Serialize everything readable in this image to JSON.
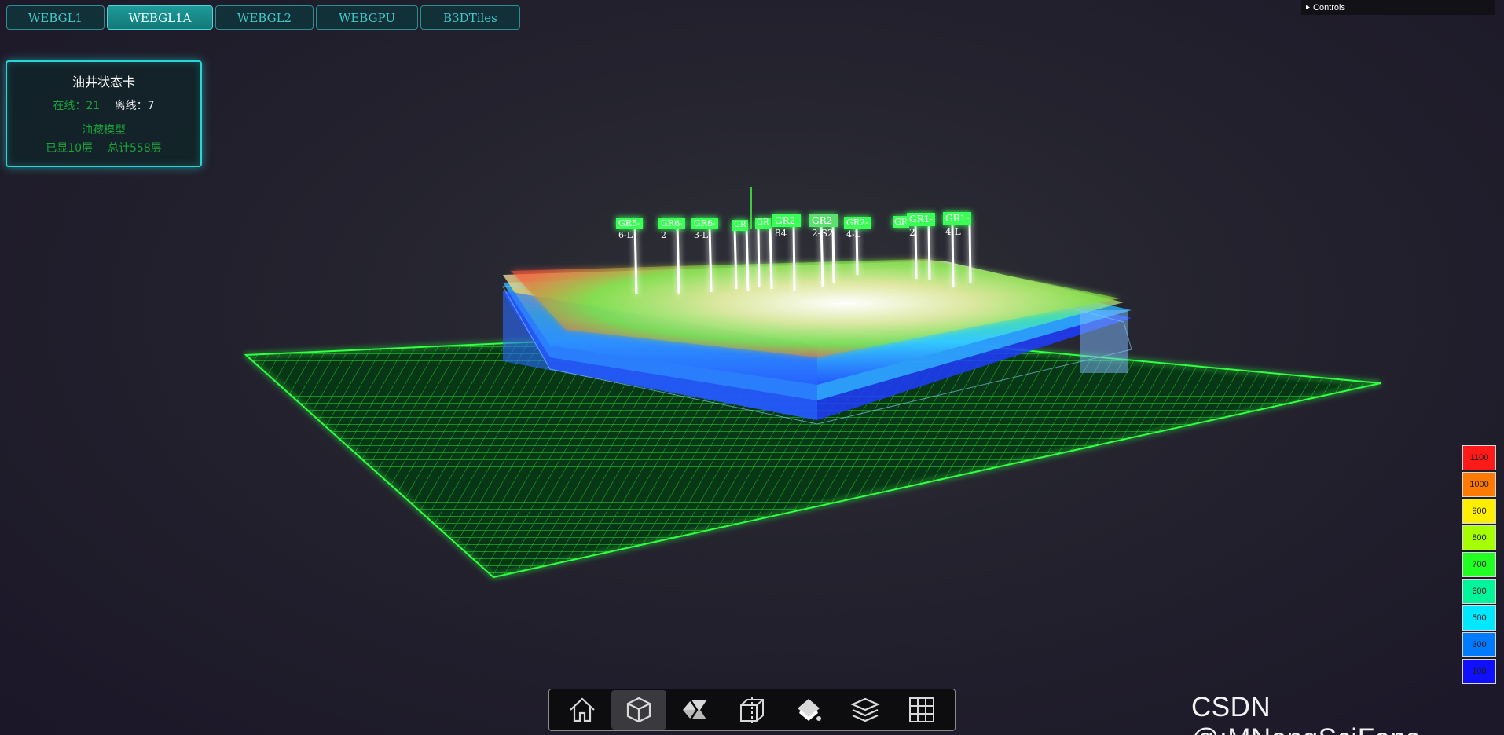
{
  "tabs": [
    {
      "label": "WEBGL1",
      "active": false
    },
    {
      "label": "WEBGL1A",
      "active": true
    },
    {
      "label": "WEBGL2",
      "active": false
    },
    {
      "label": "WEBGPU",
      "active": false
    },
    {
      "label": "B3DTiles",
      "active": false
    }
  ],
  "controls": {
    "label": "Controls",
    "icon": "chevron-right-icon"
  },
  "card": {
    "title": "油井状态卡",
    "online": "在线：21",
    "offline": "离线：7",
    "model": "油藏模型",
    "shown_layers": "已显10层",
    "total_layers": "总计558层"
  },
  "well_labels": [
    "GR5-6-L",
    "GR6-2",
    "GR6-3-L",
    "GR",
    "GR",
    "GR2-84",
    "GR2-2-S2",
    "GR2-4-L",
    "GR",
    "GR1-2",
    "GR1-4-L"
  ],
  "legend": [
    {
      "label": "1100",
      "color": "#ff1a1a"
    },
    {
      "label": "1000",
      "color": "#ff7a00"
    },
    {
      "label": "900",
      "color": "#ffee00"
    },
    {
      "label": "800",
      "color": "#a6ff00"
    },
    {
      "label": "700",
      "color": "#22ff22"
    },
    {
      "label": "600",
      "color": "#00f59a"
    },
    {
      "label": "500",
      "color": "#00e8ff"
    },
    {
      "label": "300",
      "color": "#007bff"
    },
    {
      "label": "100",
      "color": "#1010ff"
    }
  ],
  "toolbar": [
    {
      "icon": "home-icon",
      "active": false
    },
    {
      "icon": "cube-icon",
      "active": true
    },
    {
      "icon": "section-icon",
      "active": false
    },
    {
      "icon": "box-clip-icon",
      "active": false
    },
    {
      "icon": "paint-bucket-icon",
      "active": false
    },
    {
      "icon": "layers-icon",
      "active": false
    },
    {
      "icon": "grid-icon",
      "active": false
    }
  ],
  "watermark": "CSDN @:MNongSciFans"
}
